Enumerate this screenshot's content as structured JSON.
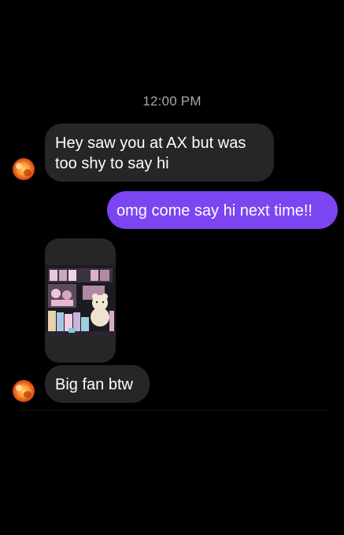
{
  "conversation": {
    "timestamp": "12:00 PM",
    "messages": [
      {
        "direction": "incoming",
        "text": "Hey saw you at AX but was too shy to say hi"
      },
      {
        "direction": "outgoing",
        "text": "omg come say hi next time!!"
      },
      {
        "direction": "incoming",
        "type": "photo"
      },
      {
        "direction": "incoming",
        "text": "Big fan btw"
      }
    ]
  },
  "colors": {
    "background": "#000000",
    "incoming_bubble": "#262626",
    "outgoing_bubble": "#7b45f2",
    "timestamp_text": "#a8a8a8"
  },
  "icons": {
    "avatar": "sender-avatar-orange-ball"
  }
}
